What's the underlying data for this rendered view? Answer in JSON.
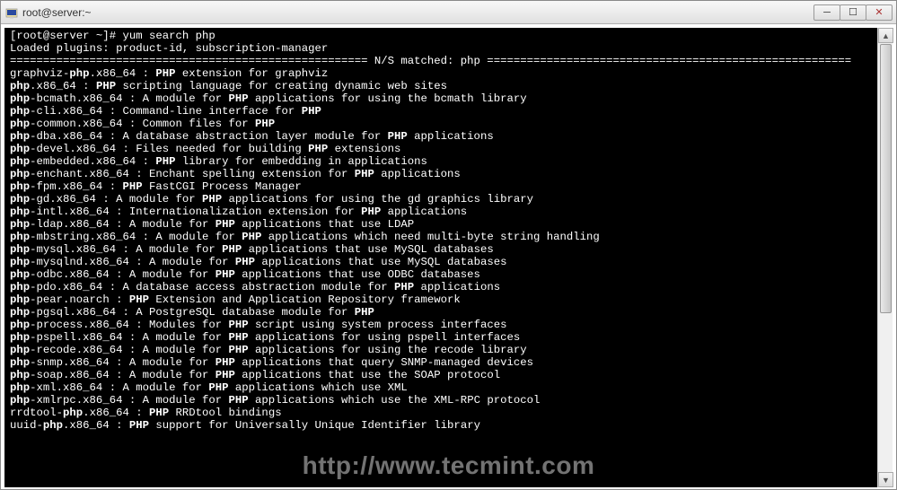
{
  "window": {
    "title": "root@server:~"
  },
  "prompt": {
    "user_host": "[root@server ~]# ",
    "command": "yum search php"
  },
  "loaded": "Loaded plugins: product-id, subscription-manager",
  "matched_label": " N/S matched: php ",
  "packages": [
    {
      "pkg": "graphviz-php.x86_64",
      "hl": [
        "php"
      ],
      "desc": " : PHP extension for graphviz",
      "dhl": [
        "PHP"
      ]
    },
    {
      "pkg": "php.x86_64",
      "hl": [
        "php"
      ],
      "desc": " : PHP scripting language for creating dynamic web sites",
      "dhl": [
        "PHP"
      ]
    },
    {
      "pkg": "php-bcmath.x86_64",
      "hl": [
        "php"
      ],
      "desc": " : A module for PHP applications for using the bcmath library",
      "dhl": [
        "PHP"
      ]
    },
    {
      "pkg": "php-cli.x86_64",
      "hl": [
        "php"
      ],
      "desc": " : Command-line interface for PHP",
      "dhl": [
        "PHP"
      ]
    },
    {
      "pkg": "php-common.x86_64",
      "hl": [
        "php"
      ],
      "desc": " : Common files for PHP",
      "dhl": [
        "PHP"
      ]
    },
    {
      "pkg": "php-dba.x86_64",
      "hl": [
        "php"
      ],
      "desc": " : A database abstraction layer module for PHP applications",
      "dhl": [
        "PHP"
      ]
    },
    {
      "pkg": "php-devel.x86_64",
      "hl": [
        "php"
      ],
      "desc": " : Files needed for building PHP extensions",
      "dhl": [
        "PHP"
      ]
    },
    {
      "pkg": "php-embedded.x86_64",
      "hl": [
        "php"
      ],
      "desc": " : PHP library for embedding in applications",
      "dhl": [
        "PHP"
      ]
    },
    {
      "pkg": "php-enchant.x86_64",
      "hl": [
        "php"
      ],
      "desc": " : Enchant spelling extension for PHP applications",
      "dhl": [
        "PHP"
      ]
    },
    {
      "pkg": "php-fpm.x86_64",
      "hl": [
        "php"
      ],
      "desc": " : PHP FastCGI Process Manager",
      "dhl": [
        "PHP"
      ]
    },
    {
      "pkg": "php-gd.x86_64",
      "hl": [
        "php"
      ],
      "desc": " : A module for PHP applications for using the gd graphics library",
      "dhl": [
        "PHP"
      ]
    },
    {
      "pkg": "php-intl.x86_64",
      "hl": [
        "php"
      ],
      "desc": " : Internationalization extension for PHP applications",
      "dhl": [
        "PHP"
      ]
    },
    {
      "pkg": "php-ldap.x86_64",
      "hl": [
        "php"
      ],
      "desc": " : A module for PHP applications that use LDAP",
      "dhl": [
        "PHP"
      ]
    },
    {
      "pkg": "php-mbstring.x86_64",
      "hl": [
        "php"
      ],
      "desc": " : A module for PHP applications which need multi-byte string handling",
      "dhl": [
        "PHP"
      ]
    },
    {
      "pkg": "php-mysql.x86_64",
      "hl": [
        "php"
      ],
      "desc": " : A module for PHP applications that use MySQL databases",
      "dhl": [
        "PHP"
      ]
    },
    {
      "pkg": "php-mysqlnd.x86_64",
      "hl": [
        "php"
      ],
      "desc": " : A module for PHP applications that use MySQL databases",
      "dhl": [
        "PHP"
      ]
    },
    {
      "pkg": "php-odbc.x86_64",
      "hl": [
        "php"
      ],
      "desc": " : A module for PHP applications that use ODBC databases",
      "dhl": [
        "PHP"
      ]
    },
    {
      "pkg": "php-pdo.x86_64",
      "hl": [
        "php"
      ],
      "desc": " : A database access abstraction module for PHP applications",
      "dhl": [
        "PHP"
      ]
    },
    {
      "pkg": "php-pear.noarch",
      "hl": [
        "php"
      ],
      "desc": " : PHP Extension and Application Repository framework",
      "dhl": [
        "PHP"
      ]
    },
    {
      "pkg": "php-pgsql.x86_64",
      "hl": [
        "php"
      ],
      "desc": " : A PostgreSQL database module for PHP",
      "dhl": [
        "PHP"
      ]
    },
    {
      "pkg": "php-process.x86_64",
      "hl": [
        "php"
      ],
      "desc": " : Modules for PHP script using system process interfaces",
      "dhl": [
        "PHP"
      ]
    },
    {
      "pkg": "php-pspell.x86_64",
      "hl": [
        "php"
      ],
      "desc": " : A module for PHP applications for using pspell interfaces",
      "dhl": [
        "PHP"
      ]
    },
    {
      "pkg": "php-recode.x86_64",
      "hl": [
        "php"
      ],
      "desc": " : A module for PHP applications for using the recode library",
      "dhl": [
        "PHP"
      ]
    },
    {
      "pkg": "php-snmp.x86_64",
      "hl": [
        "php"
      ],
      "desc": " : A module for PHP applications that query SNMP-managed devices",
      "dhl": [
        "PHP"
      ]
    },
    {
      "pkg": "php-soap.x86_64",
      "hl": [
        "php"
      ],
      "desc": " : A module for PHP applications that use the SOAP protocol",
      "dhl": [
        "PHP"
      ]
    },
    {
      "pkg": "php-xml.x86_64",
      "hl": [
        "php"
      ],
      "desc": " : A module for PHP applications which use XML",
      "dhl": [
        "PHP"
      ]
    },
    {
      "pkg": "php-xmlrpc.x86_64",
      "hl": [
        "php"
      ],
      "desc": " : A module for PHP applications which use the XML-RPC protocol",
      "dhl": [
        "PHP"
      ]
    },
    {
      "pkg": "rrdtool-php.x86_64",
      "hl": [
        "php"
      ],
      "desc": " : PHP RRDtool bindings",
      "dhl": [
        "PHP"
      ]
    },
    {
      "pkg": "uuid-php.x86_64",
      "hl": [
        "php"
      ],
      "desc": " : PHP support for Universally Unique Identifier library",
      "dhl": [
        "PHP"
      ]
    }
  ],
  "watermark": "http://www.tecmint.com"
}
